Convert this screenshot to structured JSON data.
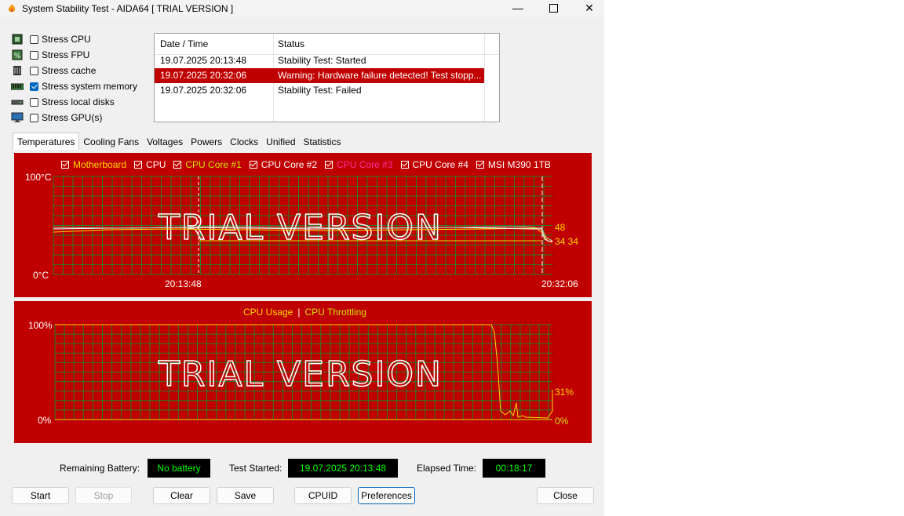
{
  "window": {
    "title": "System Stability Test - AIDA64  [ TRIAL VERSION ]"
  },
  "stress_options": [
    {
      "label": "Stress CPU",
      "checked": false,
      "icon": "cpu-chip-icon"
    },
    {
      "label": "Stress FPU",
      "checked": false,
      "icon": "fpu-percent-icon"
    },
    {
      "label": "Stress cache",
      "checked": false,
      "icon": "cache-icon"
    },
    {
      "label": "Stress system memory",
      "checked": true,
      "icon": "memory-module-icon"
    },
    {
      "label": "Stress local disks",
      "checked": false,
      "icon": "disk-icon"
    },
    {
      "label": "Stress GPU(s)",
      "checked": false,
      "icon": "monitor-icon"
    }
  ],
  "log": {
    "headers": [
      "Date / Time",
      "Status"
    ],
    "rows": [
      {
        "time": "19.07.2025 20:13:48",
        "status": "Stability Test: Started",
        "alert": false
      },
      {
        "time": "19.07.2025 20:32:06",
        "status": "Warning: Hardware failure detected! Test stopp...",
        "alert": true
      },
      {
        "time": "19.07.2025 20:32:06",
        "status": "Stability Test: Failed",
        "alert": false
      }
    ]
  },
  "tabs": [
    "Temperatures",
    "Cooling Fans",
    "Voltages",
    "Powers",
    "Clocks",
    "Unified",
    "Statistics"
  ],
  "temp_graph": {
    "legend": [
      {
        "label": "Motherboard",
        "color": "#ffd700"
      },
      {
        "label": "CPU",
        "color": "#ffffff"
      },
      {
        "label": "CPU Core #1",
        "color": "#d4e000"
      },
      {
        "label": "CPU Core #2",
        "color": "#ffffff"
      },
      {
        "label": "CPU Core #3",
        "color": "#ff2fa0"
      },
      {
        "label": "CPU Core #4",
        "color": "#ffffff"
      },
      {
        "label": "MSI M390 1TB",
        "color": "#ffffff"
      }
    ],
    "y_max": "100°C",
    "y_min": "0°C",
    "x_start": "20:13:48",
    "x_end": "20:32:06",
    "watermark": "TRIAL VERSION",
    "value_high": "48",
    "value_low": "34 34"
  },
  "usage_graph": {
    "legend_usage": "CPU Usage",
    "legend_sep": "|",
    "legend_throttle": "CPU Throttling",
    "y_max": "100%",
    "y_min": "0%",
    "watermark": "TRIAL VERSION",
    "value_usage": "31%",
    "value_throttle": "0%"
  },
  "status": {
    "battery_label": "Remaining Battery:",
    "battery_value": "No battery",
    "started_label": "Test Started:",
    "started_value": "19.07.2025 20:13:48",
    "elapsed_label": "Elapsed Time:",
    "elapsed_value": "00:18:17"
  },
  "buttons": {
    "start": "Start",
    "stop": "Stop",
    "clear": "Clear",
    "save": "Save",
    "cpuid": "CPUID",
    "preferences": "Preferences",
    "close": "Close"
  },
  "colors": {
    "graph_bg": "#c00000",
    "grid": "#2a7a2a",
    "status_text": "#00ff00",
    "alert_row": "#c00000"
  }
}
